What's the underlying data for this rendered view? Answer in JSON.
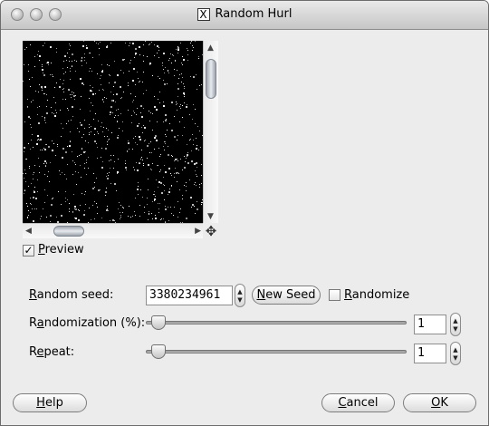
{
  "window": {
    "title": "Random Hurl",
    "title_icon": "X"
  },
  "preview": {
    "label": "Preview",
    "label_mnemonic": "P",
    "label_rest": "review",
    "checked": true
  },
  "fields": {
    "random_seed": {
      "label_mnemonic": "R",
      "label_rest": "andom seed:",
      "value": "3380234961"
    },
    "new_seed_button": {
      "mnemonic": "N",
      "rest": "ew Seed"
    },
    "randomize": {
      "mnemonic": "R",
      "rest": "andomize",
      "checked": false
    },
    "randomization": {
      "label_pre": "R",
      "label_mnemonic": "a",
      "label_rest": "ndomization (%):",
      "value": "1",
      "level_percent": 1
    },
    "repeat": {
      "label_pre": "R",
      "label_mnemonic": "e",
      "label_rest": "peat:",
      "value": "1"
    }
  },
  "buttons": {
    "help": {
      "mnemonic": "H",
      "rest": "elp"
    },
    "cancel": {
      "mnemonic": "C",
      "rest": "ancel"
    },
    "ok": {
      "mnemonic": "O",
      "rest": "K"
    }
  },
  "colors": {
    "preview_bg": "#000000",
    "dialog_bg": "#ececec"
  }
}
